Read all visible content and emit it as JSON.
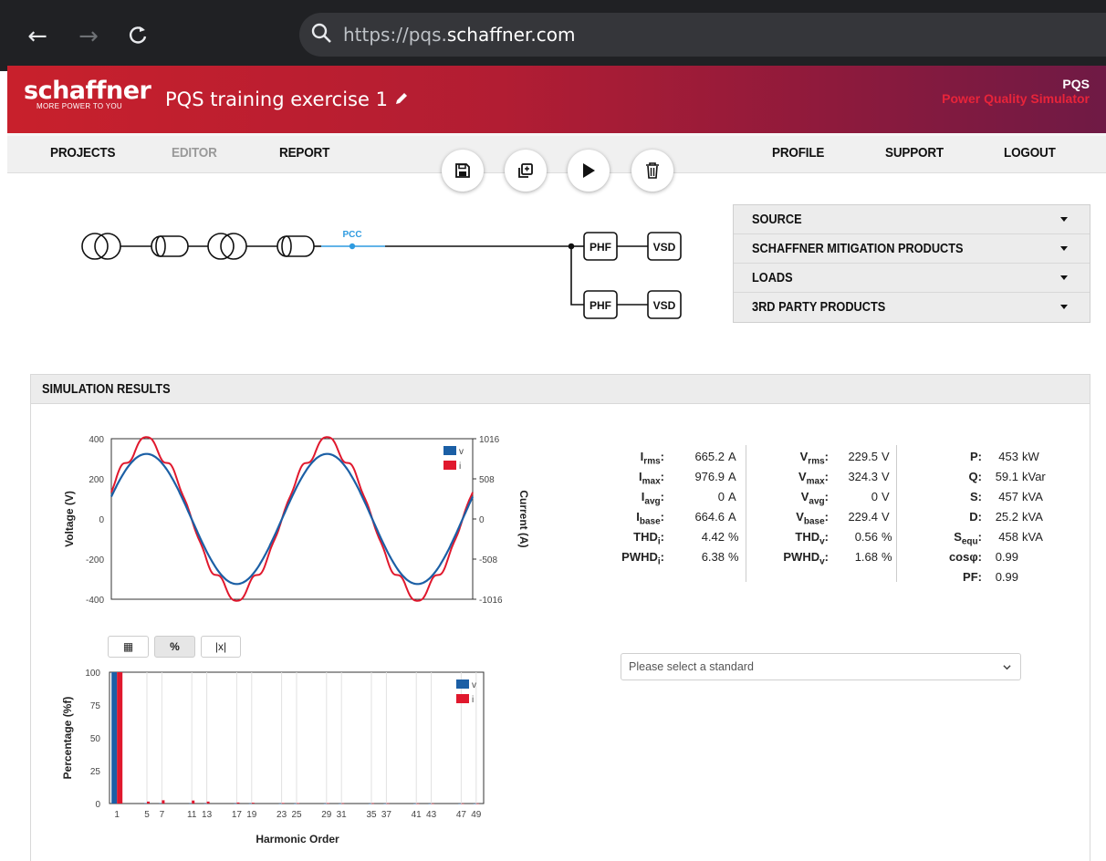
{
  "browser": {
    "url_prefix": "https://pqs.",
    "url_domain": "schaffner.com",
    "back_glyph": "←",
    "forward_glyph": "→",
    "reload_glyph": "C"
  },
  "header": {
    "logo": "schaffner",
    "logo_tagline": "MORE POWER TO YOU",
    "project_title": "PQS training exercise 1",
    "app_short": "PQS",
    "app_long": "Power Quality Simulator"
  },
  "nav": {
    "projects": "PROJECTS",
    "editor": "EDITOR",
    "report": "REPORT",
    "profile": "PROFILE",
    "support": "SUPPORT",
    "logout": "LOGOUT"
  },
  "toolbar": [
    "save-icon",
    "copy-icon",
    "play-icon",
    "trash-icon"
  ],
  "diagram": {
    "pcc_label": "PCC",
    "filter_label": "PHF",
    "drive_label": "VSD"
  },
  "palette": {
    "items": [
      "SOURCE",
      "SCHAFFNER MITIGATION PRODUCTS",
      "LOADS",
      "3RD PARTY PRODUCTS"
    ]
  },
  "results": {
    "title": "SIMULATION RESULTS",
    "current_col": [
      {
        "key": "I",
        "sub": "rms",
        "colon": ":",
        "value": "665.2",
        "unit": "A"
      },
      {
        "key": "I",
        "sub": "max",
        "colon": ":",
        "value": "976.9",
        "unit": "A"
      },
      {
        "key": "I",
        "sub": "avg",
        "colon": ":",
        "value": "0",
        "unit": "A"
      },
      {
        "key": "I",
        "sub": "base",
        "colon": ":",
        "value": "664.6",
        "unit": "A"
      },
      {
        "key": "THD",
        "sub": "i",
        "colon": ":",
        "value": "4.42",
        "unit": "%"
      },
      {
        "key": "PWHD",
        "sub": "i",
        "colon": ":",
        "value": "6.38",
        "unit": "%"
      }
    ],
    "voltage_col": [
      {
        "key": "V",
        "sub": "rms",
        "colon": ":",
        "value": "229.5",
        "unit": "V"
      },
      {
        "key": "V",
        "sub": "max",
        "colon": ":",
        "value": "324.3",
        "unit": "V"
      },
      {
        "key": "V",
        "sub": "avg",
        "colon": ":",
        "value": "0",
        "unit": "V"
      },
      {
        "key": "V",
        "sub": "base",
        "colon": ":",
        "value": "229.4",
        "unit": "V"
      },
      {
        "key": "THD",
        "sub": "v",
        "colon": ":",
        "value": "0.56",
        "unit": "%"
      },
      {
        "key": "PWHD",
        "sub": "v",
        "colon": ":",
        "value": "1.68",
        "unit": "%"
      }
    ],
    "power_col": [
      {
        "key": "P",
        "sub": "",
        "colon": ":",
        "value": "453",
        "unit": "kW"
      },
      {
        "key": "Q",
        "sub": "",
        "colon": ":",
        "value": "59.1",
        "unit": "kVar"
      },
      {
        "key": "S",
        "sub": "",
        "colon": ":",
        "value": "457",
        "unit": "kVA"
      },
      {
        "key": "D",
        "sub": "",
        "colon": ":",
        "value": "25.2",
        "unit": "kVA"
      },
      {
        "key": "S",
        "sub": "equ",
        "colon": ":",
        "value": "458",
        "unit": "kVA"
      },
      {
        "key": "cosφ",
        "sub": "",
        "colon": ":",
        "value": "0.99",
        "unit": ""
      },
      {
        "key": "PF",
        "sub": "",
        "colon": ":",
        "value": "0.99",
        "unit": ""
      }
    ],
    "harmonic_buttons": [
      "▦",
      "%",
      "|x|"
    ],
    "standard_placeholder": "Please select a standard"
  },
  "chart_data": [
    {
      "type": "line",
      "title": "",
      "xlabel": "",
      "ylabel": "Voltage (V)",
      "y2label": "Current (A)",
      "ylim": [
        -400,
        400
      ],
      "y2lim": [
        -1016,
        1016
      ],
      "yticks": [
        "400",
        "200",
        "0",
        "-200",
        "-400"
      ],
      "y2ticks": [
        "1016",
        "508",
        "0",
        "-508",
        "-1016"
      ],
      "cycles": 2,
      "series": [
        {
          "name": "v",
          "color": "#1b5fa5",
          "amplitude": 324.3
        },
        {
          "name": "i",
          "color": "#e0182d",
          "amplitude": 976.9
        }
      ],
      "legend": "top-right",
      "grid": false
    },
    {
      "type": "bar",
      "title": "",
      "xlabel": "Harmonic Order",
      "ylabel": "Percentage (%f)",
      "ylim": [
        0,
        100
      ],
      "yticks": [
        "100",
        "75",
        "50",
        "25",
        "0"
      ],
      "xticks": [
        "1",
        "5",
        "7",
        "11",
        "13",
        "17",
        "19",
        "23",
        "25",
        "29",
        "31",
        "35",
        "37",
        "41",
        "43",
        "47",
        "49"
      ],
      "categories": [
        1,
        5,
        7,
        11,
        13,
        17,
        19,
        23,
        25,
        29,
        31,
        35,
        37,
        41,
        43,
        47,
        49
      ],
      "series": [
        {
          "name": "v",
          "color": "#1b5fa5",
          "values": [
            100,
            0.3,
            0.3,
            0.2,
            0.1,
            0.1,
            0.1,
            0.05,
            0.05,
            0.05,
            0.05,
            0.03,
            0.03,
            0.02,
            0.02,
            0.02,
            0.02
          ]
        },
        {
          "name": "i",
          "color": "#e0182d",
          "values": [
            100,
            1.5,
            2.5,
            2.3,
            1.5,
            0.8,
            0.6,
            0.4,
            0.3,
            0.3,
            0.2,
            0.2,
            0.2,
            0.1,
            0.1,
            0.1,
            0.1
          ]
        }
      ],
      "legend": "top-right",
      "grid": true
    }
  ]
}
